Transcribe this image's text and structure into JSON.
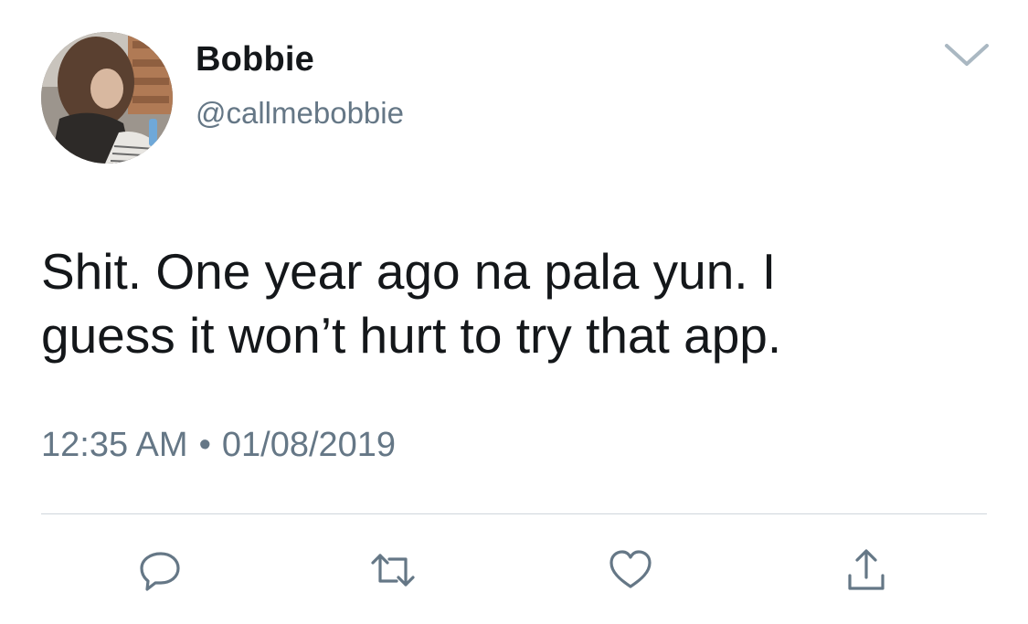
{
  "tweet": {
    "author": {
      "display_name": "Bobbie",
      "handle": "@callmebobbie"
    },
    "text_line_1": "Shit. One year ago na pala yun. I",
    "text_line_2": "guess it won’t hurt to try that app.",
    "time": "12:35 AM",
    "separator": "•",
    "date": "01/08/2019"
  },
  "icons": {
    "menu": "chevron-down-icon",
    "reply": "reply-icon",
    "retweet": "retweet-icon",
    "like": "heart-icon",
    "share": "share-icon"
  },
  "colors": {
    "text": "#14171a",
    "secondary_text": "#657786",
    "icon": "#657786",
    "divider": "#cfd6dc",
    "background": "#ffffff"
  }
}
